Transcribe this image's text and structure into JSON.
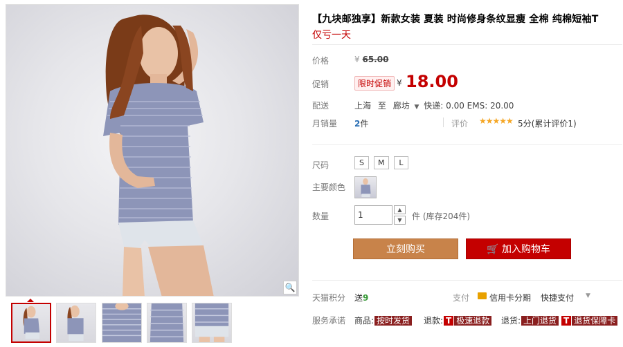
{
  "product": {
    "title": "【九块邮独享】新款女装 夏装 时尚修身条纹显瘦 全棉 纯棉短袖T",
    "subtitle": "仅亏一天"
  },
  "price": {
    "label": "价格",
    "currency": "¥",
    "original": "65.00"
  },
  "promo": {
    "label": "促销",
    "badge": "限时促销",
    "currency": "¥",
    "price": "18.00"
  },
  "shipping": {
    "label": "配送",
    "from": "上海",
    "to_word": "至",
    "to": "廊坊",
    "fees": "快递: 0.00 EMS: 20.00"
  },
  "sales": {
    "label": "月销量",
    "count": "2",
    "unit": "件",
    "rating_label": "评价",
    "stars": "★★★★★",
    "rating_text": "5分(累计评价1)"
  },
  "size": {
    "label": "尺码",
    "options": [
      "S",
      "M",
      "L"
    ]
  },
  "color": {
    "label": "主要颜色"
  },
  "quantity": {
    "label": "数量",
    "value": "1",
    "stock": "件 (库存204件)"
  },
  "actions": {
    "buy": "立刻购买",
    "cart_icon": "🛒",
    "cart": "加入购物车"
  },
  "points": {
    "label": "天猫积分",
    "prefix": "送",
    "value": "9"
  },
  "payment": {
    "label": "支付",
    "card": "信用卡分期",
    "quick": "快捷支付"
  },
  "service": {
    "label": "服务承诺",
    "items": [
      {
        "prefix": "商品:",
        "tag": "按时发货"
      },
      {
        "prefix": "退款:",
        "tagT": "T",
        "tag": "极速退款"
      },
      {
        "prefix": "退货:",
        "tag": "上门退货"
      },
      {
        "prefix": "",
        "tagT": "T",
        "tag": "退货保障卡"
      }
    ]
  },
  "icons": {
    "zoom": "magnifier-icon",
    "up": "▲",
    "down": "▼",
    "dropdown": "▼"
  },
  "colors": {
    "accent_red": "#c40000",
    "buy_orange": "#c8834a",
    "stock_blue": "#2a6fb4",
    "points_green": "#3a9b3a"
  }
}
